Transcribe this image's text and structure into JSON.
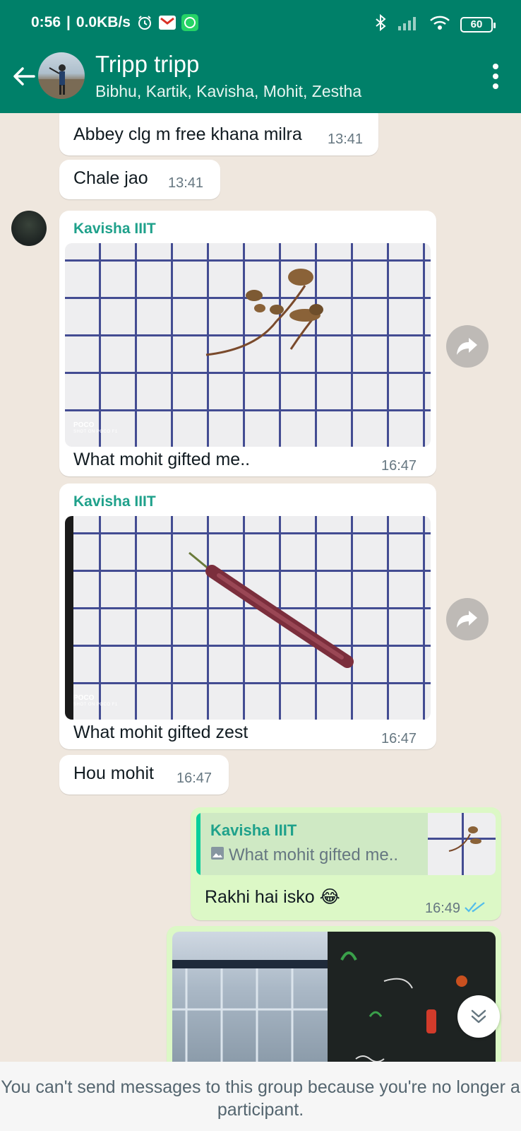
{
  "status_bar": {
    "time": "0:56",
    "network_speed": "0.0KB/s",
    "battery": "60"
  },
  "header": {
    "title": "Tripp tripp",
    "members": "Bibhu, Kartik, Kavisha, Mohit, Zestha"
  },
  "messages": [
    {
      "text": "Abbey clg m free khana milra",
      "time": "13:41"
    },
    {
      "text": "Chale jao",
      "time": "13:41"
    },
    {
      "sender": "Kavisha IIIT",
      "photo_watermark": "POCO",
      "photo_watermark_sub": "SHOT ON POCO F1",
      "caption": "What mohit gifted me..",
      "time": "16:47"
    },
    {
      "sender": "Kavisha IIIT",
      "photo_watermark": "POCO",
      "photo_watermark_sub": "SHOT ON POCO F1",
      "caption": "What mohit gifted zest",
      "time": "16:47"
    },
    {
      "text": "Hou mohit",
      "time": "16:47"
    },
    {
      "quote_sender": "Kavisha IIIT",
      "quote_text": "What mohit gifted me..",
      "text": "Rakhi hai isko",
      "emoji": "😂",
      "time": "16:49"
    }
  ],
  "footer_notice": "You can't send messages to this group because you're no longer a participant.",
  "colors": {
    "header_bg": "#008069",
    "chat_bg": "#efe7de",
    "sent_bubble": "#dcf8c6",
    "sender_name": "#1fa18b",
    "read_ticks": "#53bdeb"
  }
}
